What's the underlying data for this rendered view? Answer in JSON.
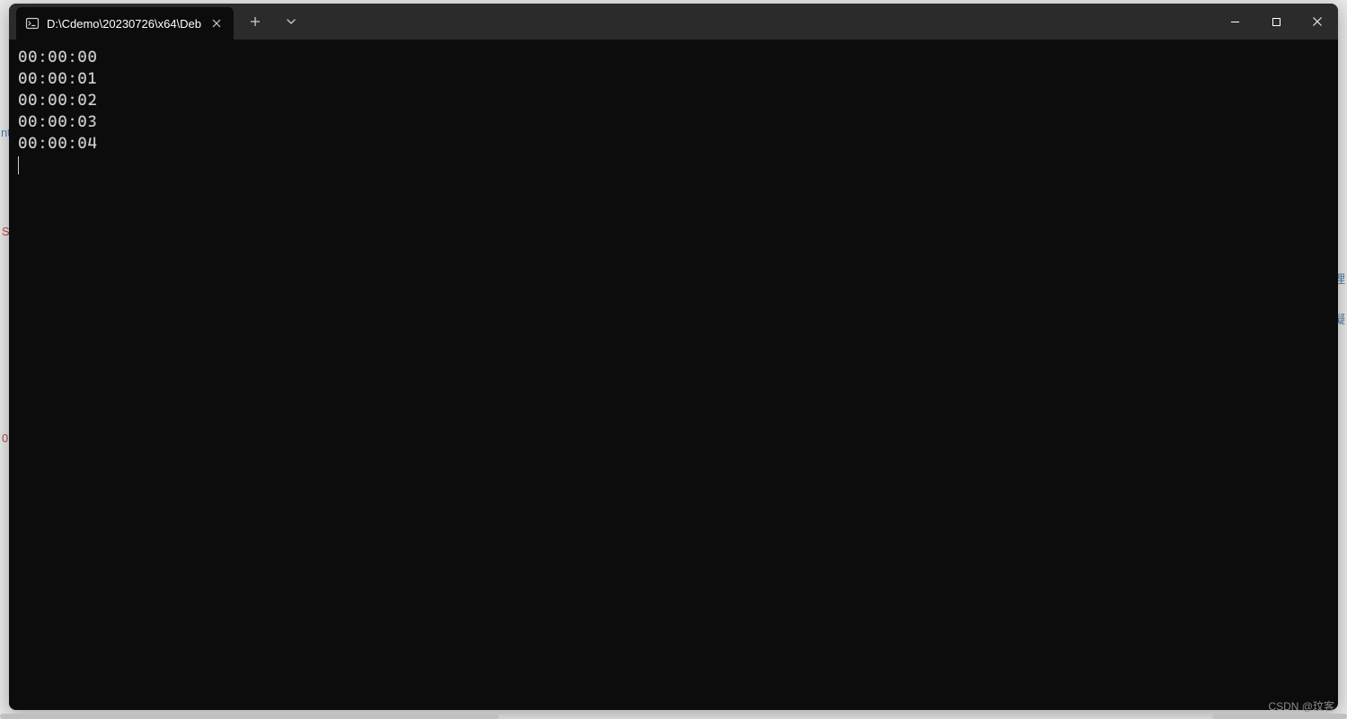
{
  "tab": {
    "title": "D:\\Cdemo\\20230726\\x64\\Deb",
    "icon": "terminal-icon"
  },
  "output": {
    "lines": [
      "00:00:00",
      "00:00:01",
      "00:00:02",
      "00:00:03",
      "00:00:04"
    ]
  },
  "watermark": "CSDN @玟客"
}
